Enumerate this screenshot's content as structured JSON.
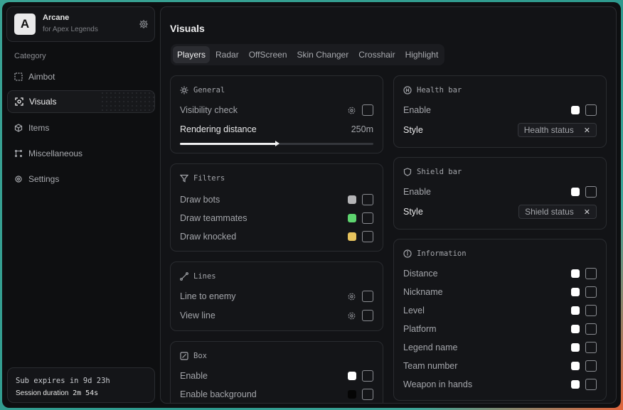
{
  "brand": {
    "logo_letter": "A",
    "title": "Arcane",
    "subtitle": "for Apex Legends",
    "settings_icon": "gear-icon"
  },
  "sidebar": {
    "category_label": "Category",
    "items": [
      {
        "label": "Aimbot",
        "icon": "crosshair-dashed-icon",
        "active": false
      },
      {
        "label": "Visuals",
        "icon": "eye-scan-icon",
        "active": true
      },
      {
        "label": "Items",
        "icon": "cube-icon",
        "active": false
      },
      {
        "label": "Miscellaneous",
        "icon": "grid-dots-icon",
        "active": false
      },
      {
        "label": "Settings",
        "icon": "gear-icon",
        "active": false
      }
    ]
  },
  "subscription": {
    "expires": "Sub expires in 9d 23h",
    "session_label": "Session duration",
    "session_value": "2m 54s"
  },
  "main": {
    "title": "Visuals",
    "tabs": [
      "Players",
      "Radar",
      "OffScreen",
      "Skin Changer",
      "Crosshair",
      "Highlight"
    ],
    "active_tab": "Players"
  },
  "general": {
    "title": "General",
    "visibility_check": "Visibility check",
    "rendering_distance": "Rendering distance",
    "rendering_distance_value": "250m",
    "rendering_distance_fraction": 0.5
  },
  "filters": {
    "title": "Filters",
    "items": [
      {
        "label": "Draw bots",
        "color": "#b4b4b6"
      },
      {
        "label": "Draw teammates",
        "color": "#5ed46f"
      },
      {
        "label": "Draw knocked",
        "color": "#e6c35d"
      }
    ]
  },
  "lines": {
    "title": "Lines",
    "items": [
      "Line to enemy",
      "View line"
    ]
  },
  "box": {
    "title": "Box",
    "items": [
      {
        "label": "Enable",
        "color": "#ffffff"
      },
      {
        "label": "Enable background",
        "color": "#050505"
      }
    ]
  },
  "health_bar": {
    "title": "Health bar",
    "enable": "Enable",
    "style": "Style",
    "style_value": "Health status"
  },
  "shield_bar": {
    "title": "Shield bar",
    "enable": "Enable",
    "style": "Style",
    "style_value": "Shield status"
  },
  "information": {
    "title": "Information",
    "items": [
      "Distance",
      "Nickname",
      "Level",
      "Platform",
      "Legend name",
      "Team number",
      "Weapon in hands"
    ]
  },
  "colors": {
    "accent_white": "#ffffff",
    "panel": "#141518",
    "border": "#2a2c30"
  }
}
